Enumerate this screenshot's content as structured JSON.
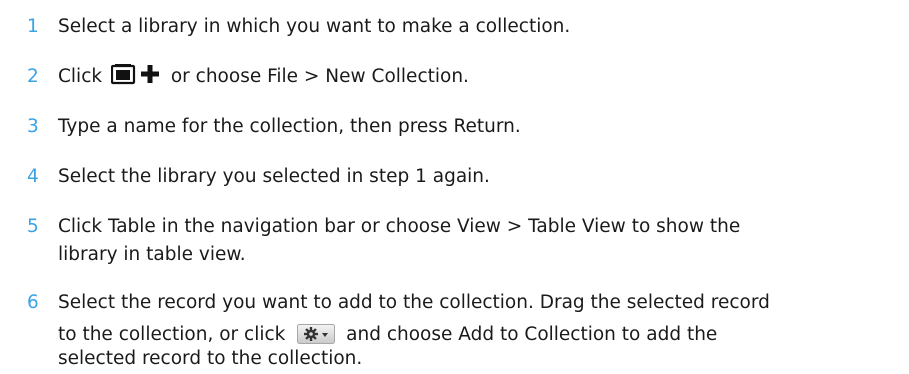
{
  "steps": [
    {
      "number": "1",
      "text": "Select a library in which you want to make a collection."
    },
    {
      "number": "2",
      "before": "Click",
      "after": "or choose File > New Collection.",
      "icon": "new-collection-icon"
    },
    {
      "number": "3",
      "text": "Type a name for the collection, then press Return."
    },
    {
      "number": "4",
      "text": "Select the library you selected in step 1 again."
    },
    {
      "number": "5",
      "line1": "Click Table in the navigation bar or choose View > Table View to show the",
      "line2": "library in table view."
    },
    {
      "number": "6",
      "line1": "Select the record you want to add to the collection. Drag the selected record",
      "line2_before": "to the collection, or click",
      "line2_after": "and choose Add to Collection to add the",
      "line3": "selected record to the collection.",
      "icon": "action-gear-icon"
    }
  ],
  "colors": {
    "step_number": "#3aa3e6",
    "text": "#1a1a1a"
  }
}
